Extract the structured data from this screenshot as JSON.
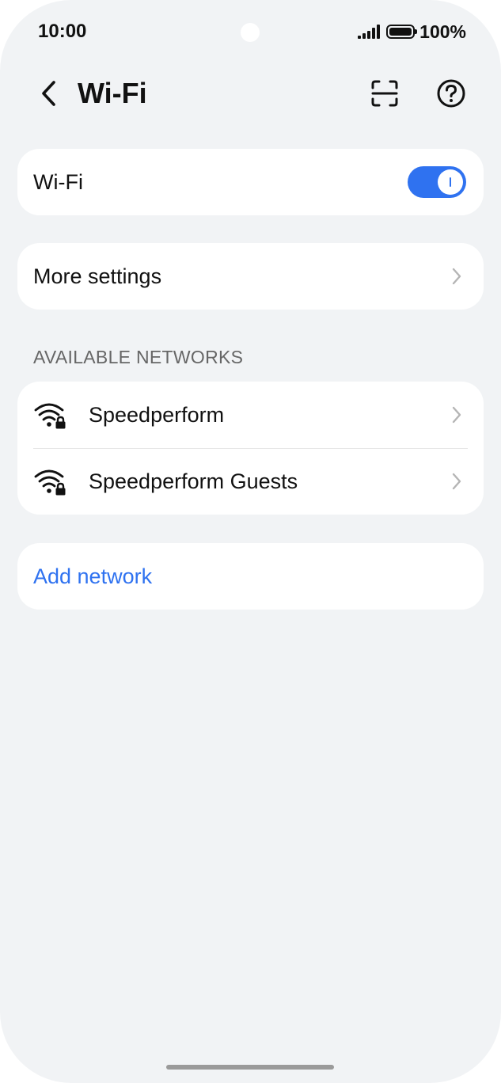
{
  "status_bar": {
    "time": "10:00",
    "battery": "100%"
  },
  "header": {
    "title": "Wi-Fi",
    "back_icon": "chevron-left-icon",
    "scan_icon": "scan-icon",
    "help_icon": "help-icon"
  },
  "wifi_toggle": {
    "label": "Wi-Fi",
    "enabled": true
  },
  "more_settings": {
    "label": "More settings"
  },
  "available_networks": {
    "header": "AVAILABLE NETWORKS",
    "items": [
      {
        "ssid": "Speedperform",
        "icon": "wifi-locked-icon"
      },
      {
        "ssid": "Speedperform Guests",
        "icon": "wifi-locked-icon"
      }
    ]
  },
  "add_network": {
    "label": "Add network"
  },
  "colors": {
    "accent": "#2f72f0",
    "background": "#f1f3f5",
    "card": "#ffffff"
  }
}
